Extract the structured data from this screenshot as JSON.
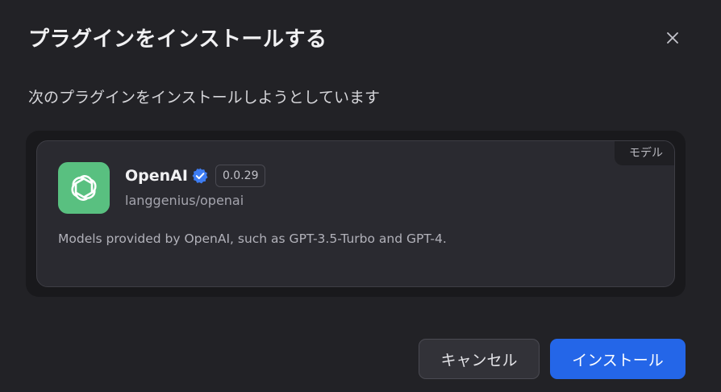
{
  "dialog": {
    "title": "プラグインをインストールする",
    "subtitle": "次のプラグインをインストールしようとしています",
    "close_icon": "close-icon"
  },
  "plugin": {
    "category_badge": "モデル",
    "logo_icon": "openai-logo-icon",
    "logo_color": "#59c080",
    "name": "OpenAI",
    "verified_icon": "verified-badge-icon",
    "verified_color": "#3d7cf2",
    "version": "0.0.29",
    "org": "langgenius",
    "separator": "/",
    "package": "openai",
    "description": "Models provided by OpenAI, such as GPT-3.5-Turbo and GPT-4."
  },
  "actions": {
    "cancel_label": "キャンセル",
    "install_label": "インストール",
    "install_color": "#2466e8"
  }
}
